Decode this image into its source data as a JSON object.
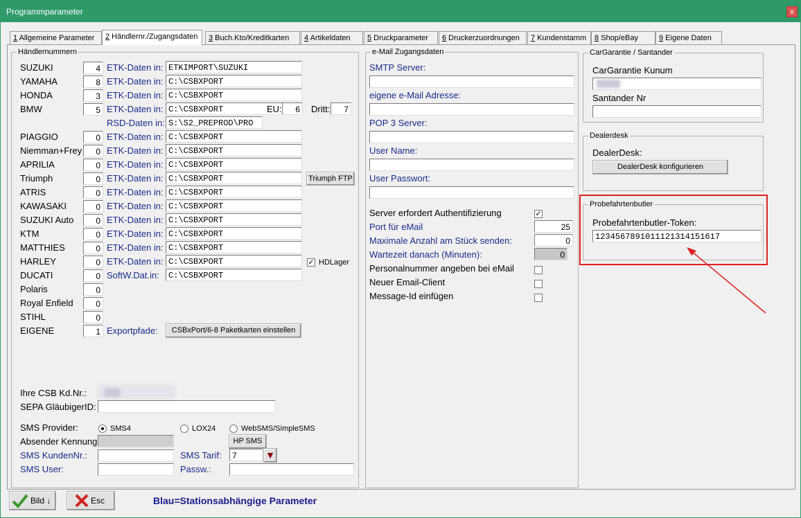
{
  "window": {
    "title": "Programmparameter",
    "close": "x"
  },
  "tabs": [
    {
      "num": "1",
      "label": " Allgemeine Parameter"
    },
    {
      "num": "2",
      "label": " Händlernr./Zugangsdaten"
    },
    {
      "num": "3",
      "label": " Buch.Kto/Kreditkarten"
    },
    {
      "num": "4",
      "label": " Artikeldaten"
    },
    {
      "num": "5",
      "label": " Druckparameter"
    },
    {
      "num": "6",
      "label": " Druckerzuordnungen"
    },
    {
      "num": "7",
      "label": " Kundenstamm"
    },
    {
      "num": "8",
      "label": " Shop/eBay"
    },
    {
      "num": "9",
      "label": " Eigene Daten"
    }
  ],
  "dealers": {
    "caption": "Händlernummern",
    "rows": [
      {
        "name": "SUZUKI",
        "value": "4",
        "etk_label": "ETK-Daten in:",
        "path": "ETKIMPORT\\SUZUKI"
      },
      {
        "name": "YAMAHA",
        "value": "8",
        "etk_label": "ETK-Daten in:",
        "path": "C:\\CSBXPORT"
      },
      {
        "name": "HONDA",
        "value": "3",
        "etk_label": "ETK-Daten in:",
        "path": "C:\\CSBXPORT"
      },
      {
        "name": "BMW",
        "value": "5",
        "etk_label": "ETK-Daten in:",
        "path": "C:\\CSBXPORT"
      },
      {
        "name": "",
        "value": "",
        "etk_label": "RSD-Daten in:",
        "path": "S:\\S2_PREPROD\\PRO"
      },
      {
        "name": "PIAGGIO",
        "value": "0",
        "etk_label": "ETK-Daten in:",
        "path": "C:\\CSBXPORT"
      },
      {
        "name": "Niemman+Frey",
        "value": "0",
        "etk_label": "ETK-Daten in:",
        "path": "C:\\CSBXPORT"
      },
      {
        "name": "APRILIA",
        "value": "0",
        "etk_label": "ETK-Daten in:",
        "path": "C:\\CSBXPORT"
      },
      {
        "name": "Triumph",
        "value": "0",
        "etk_label": "ETK-Daten in:",
        "path": "C:\\CSBXPORT"
      },
      {
        "name": "ATRIS",
        "value": "0",
        "etk_label": "ETK-Daten in:",
        "path": "C:\\CSBXPORT"
      },
      {
        "name": "KAWASAKI",
        "value": "0",
        "etk_label": "ETK-Daten in:",
        "path": "C:\\CSBXPORT"
      },
      {
        "name": "SUZUKI Auto",
        "value": "0",
        "etk_label": "ETK-Daten in:",
        "path": "C:\\CSBXPORT"
      },
      {
        "name": "KTM",
        "value": "0",
        "etk_label": "ETK-Daten in:",
        "path": "C:\\CSBXPORT"
      },
      {
        "name": "MATTHIES",
        "value": "0",
        "etk_label": "ETK-Daten in:",
        "path": "C:\\CSBXPORT"
      },
      {
        "name": "HARLEY",
        "value": "0",
        "etk_label": "ETK-Daten in:",
        "path": "C:\\CSBXPORT"
      },
      {
        "name": "DUCATI",
        "value": "0",
        "etk_label": "SoftW.Dat.in:",
        "path": "C:\\CSBXPORT"
      },
      {
        "name": "Polaris",
        "value": "0",
        "etk_label": "",
        "path": ""
      },
      {
        "name": "Royal Enfield",
        "value": "0",
        "etk_label": "",
        "path": ""
      },
      {
        "name": "STIHL",
        "value": "0",
        "etk_label": "",
        "path": ""
      },
      {
        "name": "EIGENE",
        "value": "1",
        "etk_label": "",
        "path": ""
      }
    ],
    "eu_label": "EU:",
    "eu_value": "6",
    "dritt_label": "Dritt:",
    "dritt_value": "7",
    "triumph_ftp": "Triumph FTP",
    "hdlager_label": "HDLager",
    "hdlager_checked": "✓",
    "export_label": "Exportpfade:",
    "export_button": "CSBxPort/6-8 Paketkarten einstellen",
    "csb_label": "Ihre CSB Kd.Nr.:",
    "sepa_label": "SEPA GläubigerID:",
    "sms_provider_label": "SMS Provider:",
    "sms_options": [
      "SMS4",
      "LOX24",
      "WebSMS/SimpleSMS"
    ],
    "absender_label": "Absender Kennung",
    "hpsms_button": "HP SMS",
    "sms_kunden_label": "SMS KundenNr.:",
    "sms_tarif_label": "SMS Tarif:",
    "sms_tarif_value": "7",
    "sms_user_label": "SMS User:",
    "passw_label": "Passw.:"
  },
  "email": {
    "caption": "e-Mail Zugangsdaten",
    "smtp_label": "SMTP Server:",
    "address_label": "eigene e-Mail Adresse:",
    "pop3_label": "POP 3 Server:",
    "user_label": "User Name:",
    "pass_label": "User Passwort:",
    "auth_label": "Server erfordert Authentifizierung",
    "auth_checked": "✓",
    "port_label": "Port für eMail",
    "port_value": "25",
    "max_label": "Maximale Anzahl am Stück senden:",
    "max_value": "0",
    "wait_label": "Wartezeit danach (Minuten):",
    "wait_value": "0",
    "personal_label": "Personalnummer angeben bei eMail",
    "newclient_label": "Neuer Email-Client",
    "msgid_label": "Message-Id einfügen"
  },
  "cargarantie": {
    "caption": "CarGarantie / Santander",
    "kunum_label": "CarGarantie Kunum",
    "santander_label": "Santander Nr"
  },
  "dealerdesk": {
    "caption": "Dealerdesk",
    "label": "DealerDesk:",
    "button": "DealerDesk konfigurieren"
  },
  "probefahrt": {
    "caption": "Probefahrtenbutler",
    "token_label": "Probefahrtenbutler-Token:",
    "token_value": "1234567891011121314151617"
  },
  "footer": {
    "bild_button": "Bild",
    "esc_button": "Esc",
    "note": "Blau=Stationsabhängige Parameter"
  },
  "colors": {
    "titlebar": "#2e9a6a",
    "blue_text": "#1a2a8a",
    "highlight": "#e02020"
  }
}
